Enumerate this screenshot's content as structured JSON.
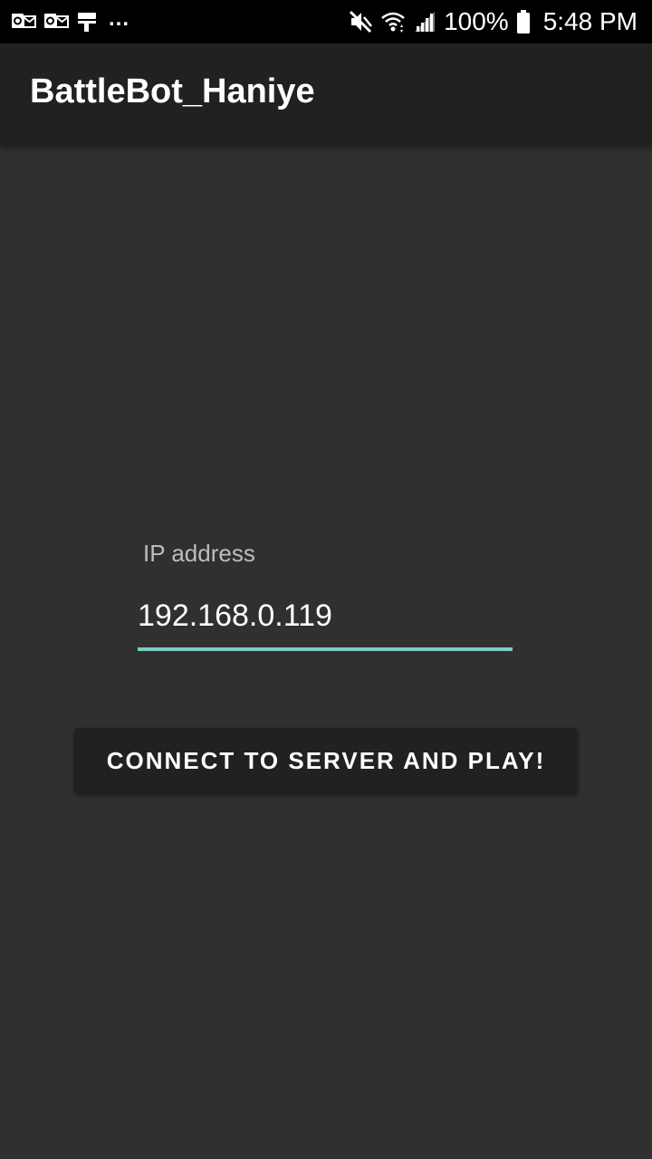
{
  "status_bar": {
    "left_icons": [
      "outlook-icon",
      "outlook-icon",
      "paint-roller-icon"
    ],
    "more_indicator": "...",
    "right_icons": [
      "mute-icon",
      "wifi-icon",
      "signal-icon"
    ],
    "battery_text": "100%",
    "battery_icon": "battery-icon",
    "clock": "5:48 PM"
  },
  "app_bar": {
    "title": "BattleBot_Haniye"
  },
  "ip_field": {
    "label": "IP address",
    "value": "192.168.0.119"
  },
  "connect_button": {
    "label": "CONNECT TO SERVER AND PLAY!"
  },
  "colors": {
    "background": "#303030",
    "app_bar": "#212121",
    "status_bar": "#000000",
    "accent": "#80cbc4",
    "label": "#bdbdbd",
    "button": "#212121"
  }
}
